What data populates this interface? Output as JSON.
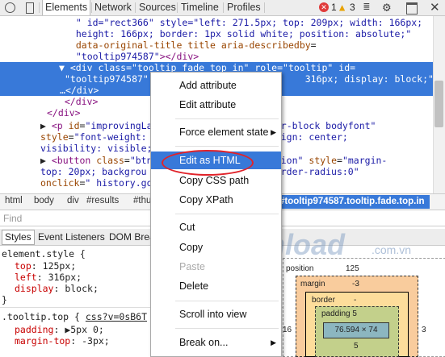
{
  "toolbar": {
    "tabs": [
      "Elements",
      "Network",
      "Sources",
      "Timeline",
      "Profiles"
    ],
    "close_count": "1",
    "warn_count": "3"
  },
  "code_lines": [
    [
      {
        "c": "val",
        "t": "  \" id=\"rect366\" style=\"left: 271.5px; top: 209px; width: 166px;"
      }
    ],
    [
      {
        "c": "val",
        "t": "  height: 166px; border: 1px solid white; position: absolute;\""
      }
    ],
    [
      {
        "c": "attr",
        "t": "  data-original-title"
      },
      {
        "c": "txt",
        "t": " "
      },
      {
        "c": "attr",
        "t": "title aria-describedby"
      },
      {
        "c": "txt",
        "t": "="
      }
    ],
    [
      {
        "c": "val",
        "t": "  \"tooltip974587\""
      },
      {
        "c": "tag",
        "t": "></div>"
      }
    ],
    [
      {
        "c": "txt",
        "t": "▼ "
      },
      {
        "c": "tag",
        "t": "<div "
      },
      {
        "c": "attr",
        "t": "class"
      },
      {
        "c": "txt",
        "t": "="
      },
      {
        "c": "val",
        "t": "\"tooltip fade top in\" "
      },
      {
        "c": "attr",
        "t": "role"
      },
      {
        "c": "txt",
        "t": "="
      },
      {
        "c": "val",
        "t": "\"tooltip\" "
      },
      {
        "c": "attr",
        "t": "id"
      },
      {
        "c": "txt",
        "t": "="
      }
    ],
    [
      {
        "c": "val",
        "t": "\"tooltip974587\" "
      },
      {
        "c": "attr",
        "t": "s"
      },
      {
        "c": "txt",
        "t": "                          "
      },
      {
        "c": "val",
        "t": "316px; display: block;\""
      },
      {
        "c": "tag",
        "t": ">"
      }
    ],
    [
      {
        "c": "txt",
        "t": "…"
      },
      {
        "c": "tag",
        "t": "</div>"
      }
    ],
    [
      {
        "c": "tag",
        "t": "  </div>"
      }
    ],
    [
      {
        "c": "tag",
        "t": "</div>"
      }
    ],
    [
      {
        "c": "txt",
        "t": "▶ "
      },
      {
        "c": "tag",
        "t": "<p "
      },
      {
        "c": "attr",
        "t": "id"
      },
      {
        "c": "txt",
        "t": "="
      },
      {
        "c": "val",
        "t": "\"improvingLa"
      },
      {
        "c": "txt",
        "t": "                  "
      },
      {
        "c": "val",
        "t": "center-block bodyfont\""
      }
    ],
    [
      {
        "c": "attr",
        "t": "style"
      },
      {
        "c": "txt",
        "t": "="
      },
      {
        "c": "val",
        "t": "\"font-weight:"
      },
      {
        "c": "txt",
        "t": "                  "
      },
      {
        "c": "val",
        "t": "ext-align: center;"
      }
    ],
    [
      {
        "c": "val",
        "t": "visibility: visible;"
      }
    ],
    [
      {
        "c": "txt",
        "t": "▶ "
      },
      {
        "c": "tag",
        "t": "<button "
      },
      {
        "c": "attr",
        "t": "class"
      },
      {
        "c": "txt",
        "t": "="
      },
      {
        "c": "val",
        "t": "\"btn"
      },
      {
        "c": "txt",
        "t": "                  "
      },
      {
        "c": "val",
        "t": "k action\" "
      },
      {
        "c": "attr",
        "t": "style"
      },
      {
        "c": "txt",
        "t": "="
      },
      {
        "c": "val",
        "t": "\"margin-"
      }
    ],
    [
      {
        "c": "val",
        "t": "top: 20px; backgrou"
      },
      {
        "c": "txt",
        "t": "                  "
      },
      {
        "c": "val",
        "t": "1));border-radius:0\""
      }
    ],
    [
      {
        "c": "attr",
        "t": "onclick"
      },
      {
        "c": "txt",
        "t": "="
      },
      {
        "c": "val",
        "t": "\" history.go"
      }
    ]
  ],
  "breadcrumbs": [
    "html",
    "body",
    "div",
    "#results",
    "#thu"
  ],
  "breadcrumb_active": "#tooltip974587.tooltip.fade.top.in",
  "find_placeholder": "Find",
  "styles_tabs": [
    "Styles",
    "Event Listeners",
    "DOM Brea"
  ],
  "styles": {
    "element_style": "element.style {",
    "rules": [
      {
        "prop": "top",
        "val": "125px;"
      },
      {
        "prop": "left",
        "val": "316px;"
      },
      {
        "prop": "display",
        "val": "block;"
      }
    ],
    "close": "}",
    "tooltip_selector": ".tooltip.top {",
    "tooltip_link": "css?v=0sB6T",
    "tooltip_rules": [
      {
        "prop": "padding",
        "val": "▶5px 0;"
      },
      {
        "prop": "margin-top",
        "val": "-3px;"
      }
    ]
  },
  "box_model": {
    "position_label": "position",
    "position_val": "125",
    "margin_label": "margin",
    "margin_val": "-3",
    "border_label": "border",
    "border_val": "-",
    "padding_label": "padding 5",
    "content": "76.594 × 74",
    "padding_bottom": "5",
    "left_val": "16",
    "right_val": "3"
  },
  "watermark": {
    "brand": "Download",
    "tld": ".com.vn"
  },
  "menu": {
    "items": [
      {
        "label": "Add attribute"
      },
      {
        "label": "Edit attribute"
      },
      {
        "label": "Force element state"
      },
      {
        "label": "Edit as HTML"
      },
      {
        "label": "Copy CSS path"
      },
      {
        "label": "Copy XPath"
      },
      {
        "label": "Cut"
      },
      {
        "label": "Copy"
      },
      {
        "label": "Paste"
      },
      {
        "label": "Delete"
      },
      {
        "label": "Scroll into view"
      },
      {
        "label": "Break on..."
      }
    ]
  },
  "colors": {
    "selection": "#3879d9",
    "highlight_ellipse": "#e0232a",
    "tag": "#881280",
    "attr": "#994500",
    "value": "#1a1aa6"
  }
}
